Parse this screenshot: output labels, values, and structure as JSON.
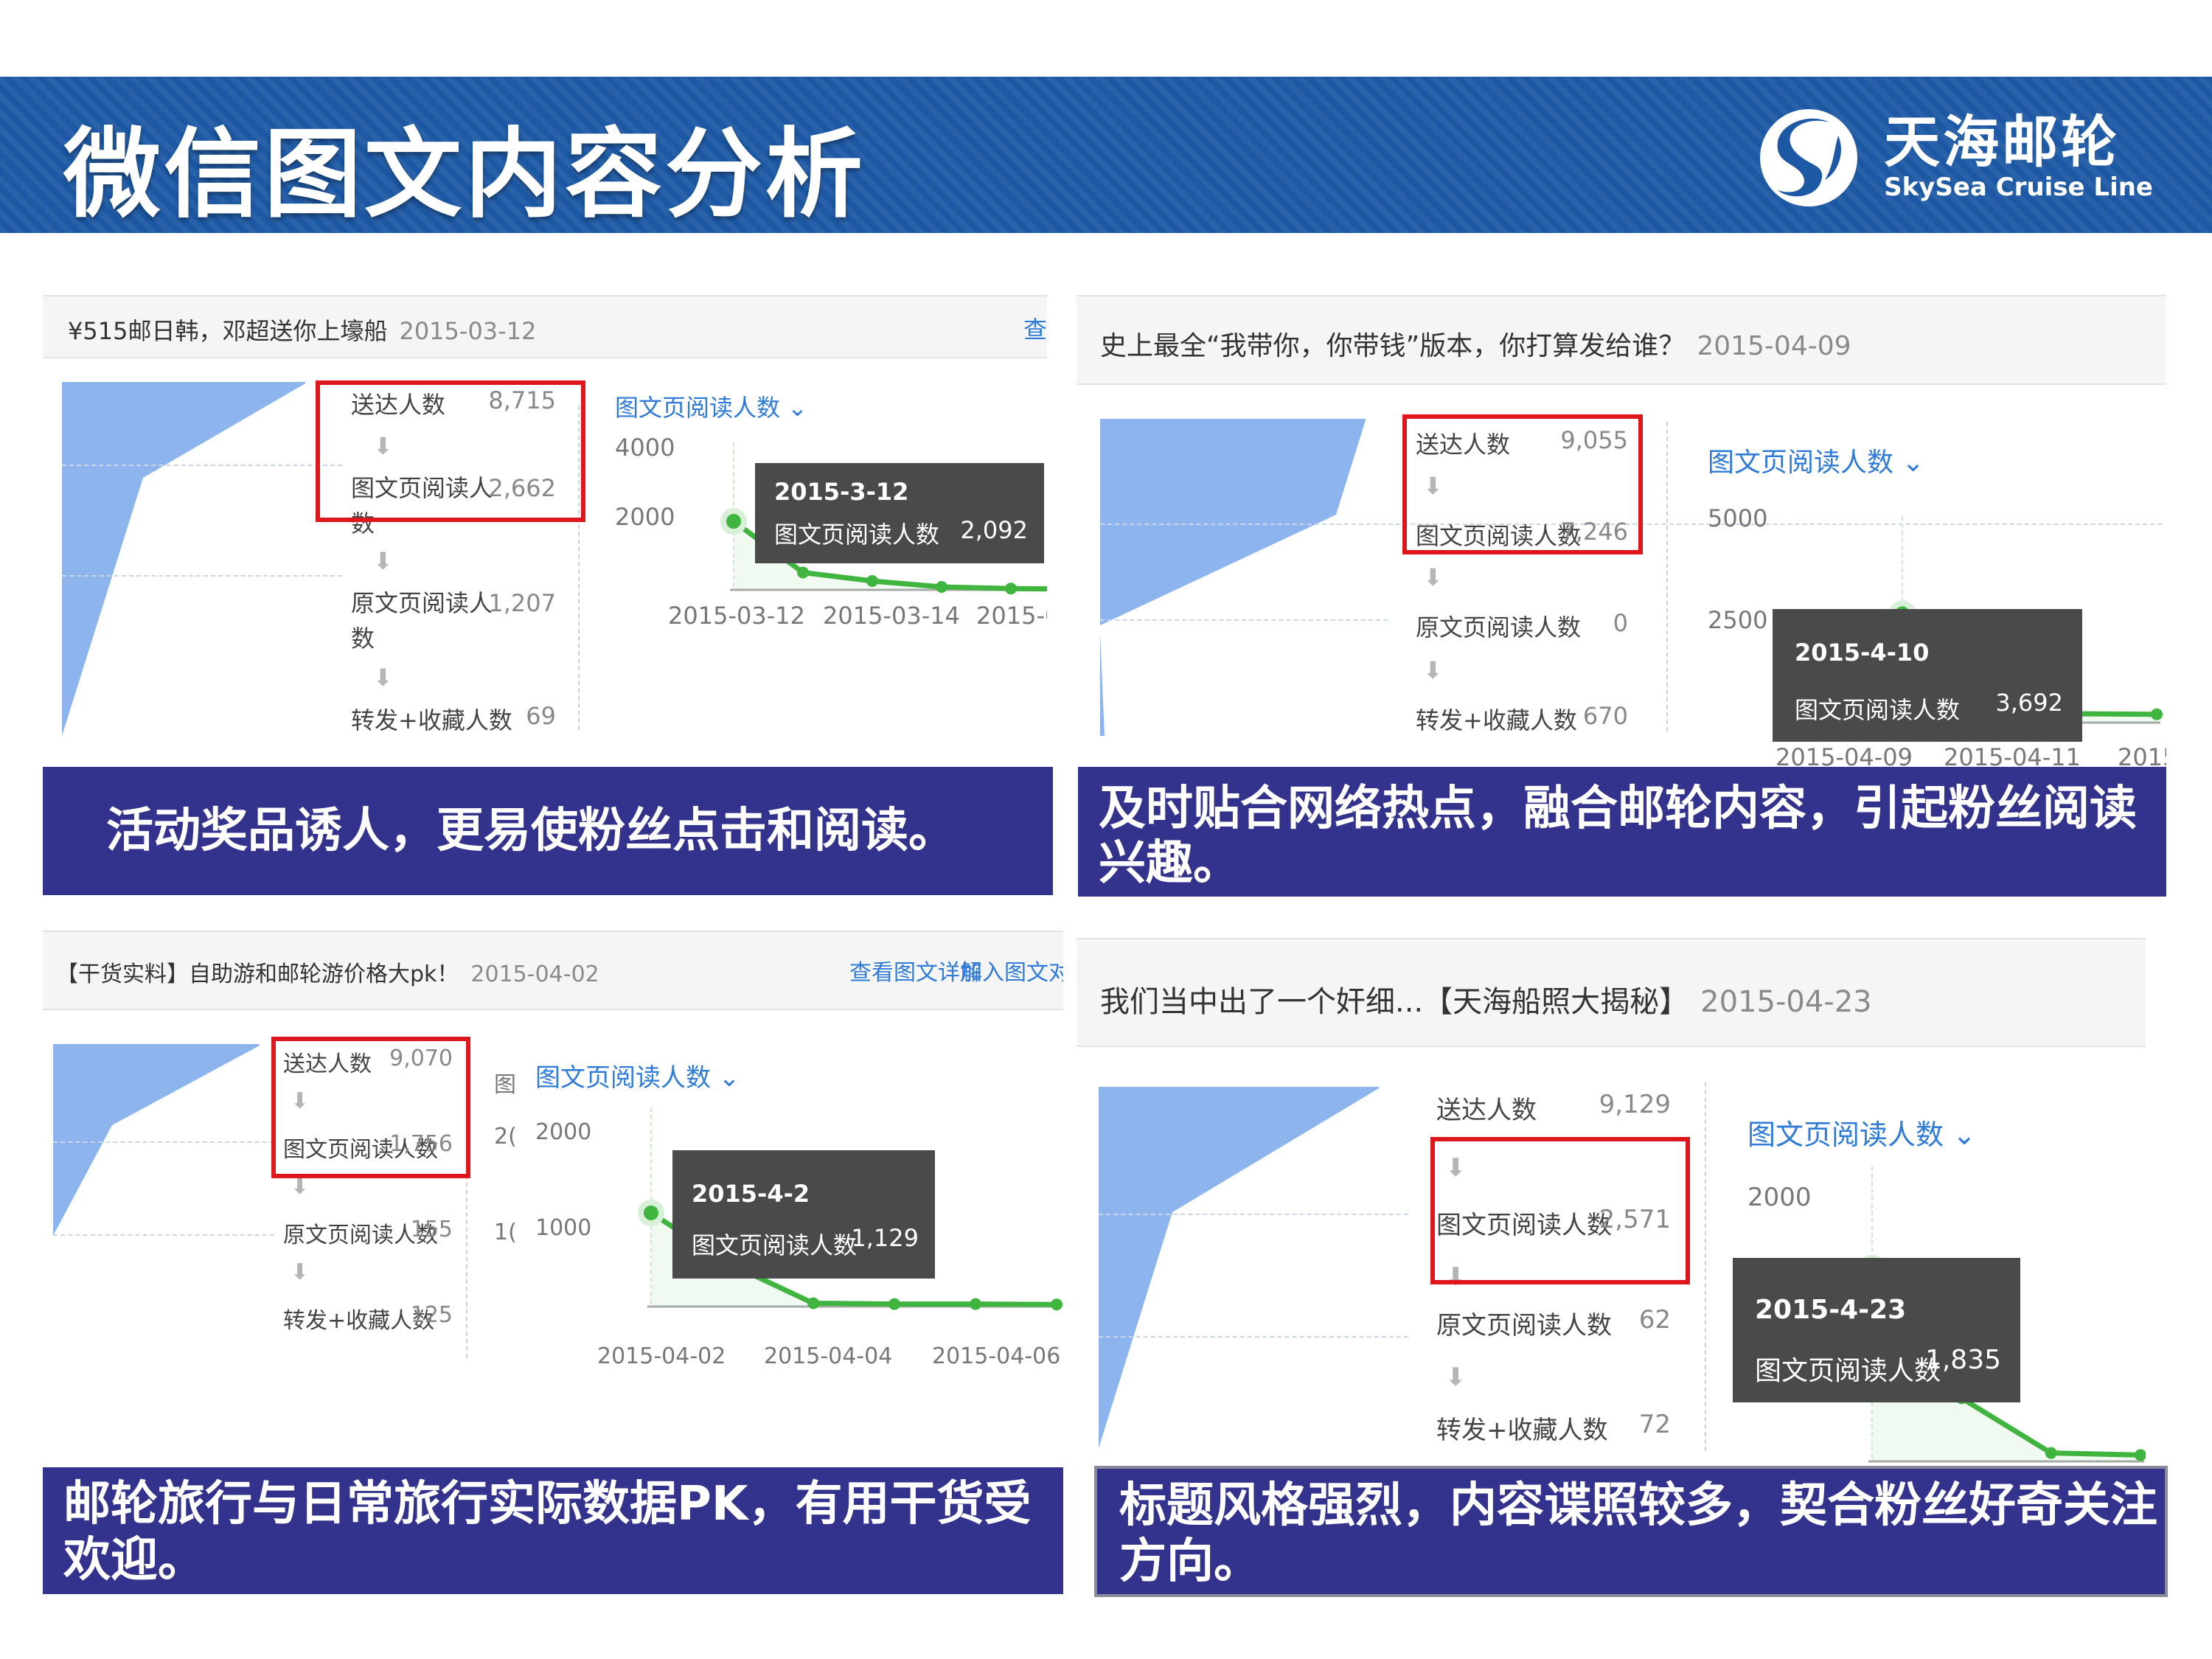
{
  "slide": {
    "title": "微信图文内容分析"
  },
  "logo": {
    "cn": "天海邮轮",
    "en": "SkySea Cruise Line"
  },
  "panels": [
    {
      "id": "p1",
      "header": "¥515邮日韩，邓超送你上壕船",
      "date": "2015-03-12",
      "links": [
        "查"
      ],
      "funnel": [
        {
          "label": "送达人数",
          "value": "8,715"
        },
        {
          "label": "图文页阅读人数",
          "value": "2,662"
        },
        {
          "label": "原文页阅读人数",
          "value": "1,207"
        },
        {
          "label": "转发+收藏人数",
          "value": "69"
        }
      ],
      "metric": "图文页阅读人数 ⌄",
      "yticks": [
        "4000",
        "2000"
      ],
      "xticks": [
        "2015-03-12",
        "2015-03-14",
        "2015-0"
      ],
      "chart_data": {
        "type": "line",
        "ylim": [
          0,
          4500
        ],
        "x": [
          "2015-03-12",
          "2015-03-13",
          "2015-03-14",
          "2015-03-15",
          "2015-03-16",
          "2015-03-17"
        ],
        "values": [
          2092,
          530,
          270,
          90,
          40,
          20
        ]
      },
      "tooltip": {
        "date": "2015-3-12",
        "label": "图文页阅读人数",
        "value": "2,092"
      },
      "caption": "活动奖品诱人，更易使粉丝点击和阅读。"
    },
    {
      "id": "p2",
      "header": "史上最全“我带你，你带钱”版本，你打算发给谁？",
      "date": "2015-04-09",
      "links": [],
      "funnel": [
        {
          "label": "送达人数",
          "value": "9,055"
        },
        {
          "label": "图文页阅读人数",
          "value": "7,246"
        },
        {
          "label": "原文页阅读人数",
          "value": "0"
        },
        {
          "label": "转发+收藏人数",
          "value": "670"
        }
      ],
      "metric": "图文页阅读人数 ⌄",
      "yticks": [
        "5000",
        "2500"
      ],
      "xticks": [
        "2015-04-09",
        "2015-04-11",
        "2015-"
      ],
      "chart_data": {
        "type": "line",
        "ylim": [
          0,
          7000
        ],
        "x": [
          "2015-04-09",
          "2015-04-10",
          "2015-04-11",
          "2015-04-12",
          "2015-04-13"
        ],
        "values": [
          1500,
          3692,
          900,
          300,
          280
        ]
      },
      "tooltip": {
        "date": "2015-4-10",
        "label": "图文页阅读人数",
        "value": "3,692"
      },
      "caption": "及时贴合网络热点，融合邮轮内容，引起粉丝阅读兴趣。"
    },
    {
      "id": "p3",
      "header": "【干货实料】自助游和邮轮游价格大pk！",
      "date": "2015-04-02",
      "links": [
        "查看图文详解",
        "加入图文对"
      ],
      "funnel": [
        {
          "label": "送达人数",
          "value": "9,070"
        },
        {
          "label": "图文页阅读人数",
          "value": "1,756"
        },
        {
          "label": "原文页阅读人数",
          "value": "155"
        },
        {
          "label": "转发+收藏人数",
          "value": "125"
        }
      ],
      "metric": "图文页阅读人数 ⌄",
      "yticks": [
        "2000",
        "1000"
      ],
      "xticks": [
        "2015-04-02",
        "2015-04-04",
        "2015-04-06"
      ],
      "cut_ticks": [
        "图",
        "2(",
        "1("
      ],
      "chart_data": {
        "type": "line",
        "ylim": [
          0,
          2400
        ],
        "x": [
          "2015-04-02",
          "2015-04-03",
          "2015-04-04",
          "2015-04-05",
          "2015-04-06",
          "2015-04-07"
        ],
        "values": [
          1129,
          500,
          40,
          30,
          30,
          25
        ]
      },
      "tooltip": {
        "date": "2015-4-2",
        "label": "图文页阅读人数",
        "value": "1,129"
      },
      "caption": "邮轮旅行与日常旅行实际数据PK，有用干货受欢迎。"
    },
    {
      "id": "p4",
      "header": "我们当中出了一个奸细...【天海船照大揭秘】",
      "date": "2015-04-23",
      "links": [],
      "funnel": [
        {
          "label": "送达人数",
          "value": "9,129"
        },
        {
          "label": "图文页阅读人数",
          "value": "2,571"
        },
        {
          "label": "原文页阅读人数",
          "value": "62"
        },
        {
          "label": "转发+收藏人数",
          "value": "72"
        }
      ],
      "metric": "图文页阅读人数 ⌄",
      "yticks": [
        "2000"
      ],
      "xticks": [],
      "chart_data": {
        "type": "line",
        "ylim": [
          0,
          2800
        ],
        "x": [
          "2015-04-23",
          "2015-04-24",
          "2015-04-25",
          "2015-04-26"
        ],
        "values": [
          1835,
          600,
          80,
          60
        ]
      },
      "tooltip": {
        "date": "2015-4-23",
        "label": "图文页阅读人数",
        "value": "1,835"
      },
      "caption": "标题风格强烈，内容谍照较多，契合粉丝好奇关注方向。"
    }
  ],
  "colors": {
    "banner": "#1c58a4",
    "caption": "#33338e",
    "highlight": "#e0161d",
    "line": "#3fb43f",
    "funnel": "#8db4ec"
  }
}
